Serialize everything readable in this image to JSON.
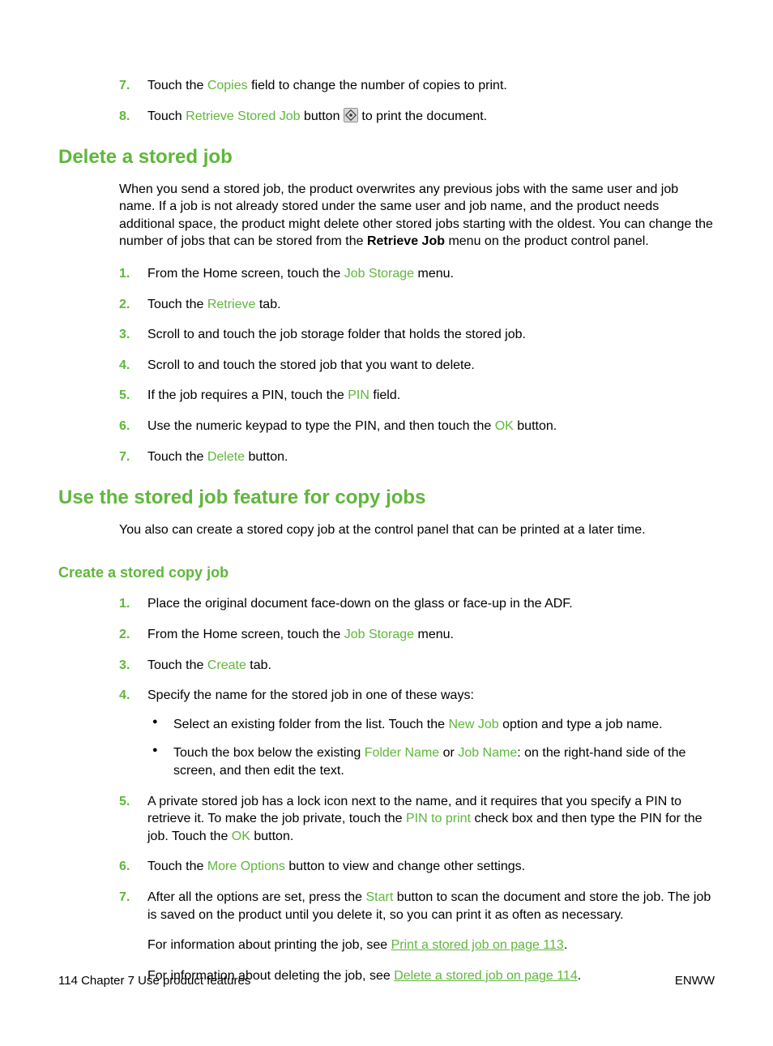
{
  "topSteps": [
    {
      "num": "7.",
      "parts": [
        {
          "t": "Touch the "
        },
        {
          "t": "Copies",
          "cls": "green"
        },
        {
          "t": " field to change the number of copies to print."
        }
      ]
    },
    {
      "num": "8.",
      "parts": [
        {
          "t": "Touch "
        },
        {
          "t": "Retrieve Stored Job",
          "cls": "green"
        },
        {
          "t": " button "
        },
        {
          "icon": "start-icon"
        },
        {
          "t": " to print the document."
        }
      ]
    }
  ],
  "sec1": {
    "title": "Delete a stored job",
    "para": [
      {
        "t": "When you send a stored job, the product overwrites any previous jobs with the same user and job name. If a job is not already stored under the same user and job name, and the product needs additional space, the product might delete other stored jobs starting with the oldest. You can change the number of jobs that can be stored from the "
      },
      {
        "t": "Retrieve Job",
        "cls": "bold"
      },
      {
        "t": " menu on the product control panel."
      }
    ],
    "steps": [
      {
        "num": "1.",
        "parts": [
          {
            "t": "From the Home screen, touch the "
          },
          {
            "t": "Job Storage",
            "cls": "green"
          },
          {
            "t": " menu."
          }
        ]
      },
      {
        "num": "2.",
        "parts": [
          {
            "t": "Touch the "
          },
          {
            "t": "Retrieve",
            "cls": "green"
          },
          {
            "t": " tab."
          }
        ]
      },
      {
        "num": "3.",
        "parts": [
          {
            "t": "Scroll to and touch the job storage folder that holds the stored job."
          }
        ]
      },
      {
        "num": "4.",
        "parts": [
          {
            "t": "Scroll to and touch the stored job that you want to delete."
          }
        ]
      },
      {
        "num": "5.",
        "parts": [
          {
            "t": "If the job requires a PIN, touch the "
          },
          {
            "t": "PIN",
            "cls": "green"
          },
          {
            "t": " field."
          }
        ]
      },
      {
        "num": "6.",
        "parts": [
          {
            "t": "Use the numeric keypad to type the PIN, and then touch the "
          },
          {
            "t": "OK",
            "cls": "green"
          },
          {
            "t": " button."
          }
        ]
      },
      {
        "num": "7.",
        "parts": [
          {
            "t": "Touch the "
          },
          {
            "t": "Delete",
            "cls": "green"
          },
          {
            "t": " button."
          }
        ]
      }
    ]
  },
  "sec2": {
    "title": "Use the stored job feature for copy jobs",
    "para": "You also can create a stored copy job at the control panel that can be printed at a later time.",
    "sub": {
      "title": "Create a stored copy job",
      "steps": [
        {
          "num": "1.",
          "parts": [
            {
              "t": "Place the original document face-down on the glass or face-up in the ADF."
            }
          ]
        },
        {
          "num": "2.",
          "parts": [
            {
              "t": "From the Home screen, touch the "
            },
            {
              "t": "Job Storage",
              "cls": "green"
            },
            {
              "t": " menu."
            }
          ]
        },
        {
          "num": "3.",
          "parts": [
            {
              "t": "Touch the "
            },
            {
              "t": "Create",
              "cls": "green"
            },
            {
              "t": " tab."
            }
          ]
        },
        {
          "num": "4.",
          "parts": [
            {
              "t": "Specify the name for the stored job in one of these ways:"
            }
          ],
          "bullets": [
            [
              {
                "t": "Select an existing folder from the list. Touch the "
              },
              {
                "t": "New Job",
                "cls": "green"
              },
              {
                "t": " option and type a job name."
              }
            ],
            [
              {
                "t": "Touch the box below the existing "
              },
              {
                "t": "Folder Name",
                "cls": "green"
              },
              {
                "t": " or "
              },
              {
                "t": "Job Name",
                "cls": "green"
              },
              {
                "t": ": on the right-hand side of the screen, and then edit the text."
              }
            ]
          ]
        },
        {
          "num": "5.",
          "parts": [
            {
              "t": "A private stored job has a lock icon next to the name, and it requires that you specify a PIN to retrieve it. To make the job private, touch the "
            },
            {
              "t": "PIN to print",
              "cls": "green"
            },
            {
              "t": " check box and then type the PIN for the job. Touch the "
            },
            {
              "t": "OK",
              "cls": "green"
            },
            {
              "t": " button."
            }
          ]
        },
        {
          "num": "6.",
          "parts": [
            {
              "t": "Touch the "
            },
            {
              "t": "More Options",
              "cls": "green"
            },
            {
              "t": " button to view and change other settings."
            }
          ]
        },
        {
          "num": "7.",
          "parts": [
            {
              "t": "After all the options are set, press the "
            },
            {
              "t": "Start",
              "cls": "green"
            },
            {
              "t": " button to scan the document and store the job. The job is saved on the product until you delete it, so you can print it as often as necessary."
            }
          ],
          "extras": [
            [
              {
                "t": "For information about printing the job, see "
              },
              {
                "t": "Print a stored job on page 113",
                "cls": "link"
              },
              {
                "t": "."
              }
            ],
            [
              {
                "t": "For information about deleting the job, see "
              },
              {
                "t": "Delete a stored job on page 114",
                "cls": "link"
              },
              {
                "t": "."
              }
            ]
          ]
        }
      ]
    }
  },
  "footer": {
    "left": "114   Chapter 7   Use product features",
    "right": "ENWW"
  }
}
